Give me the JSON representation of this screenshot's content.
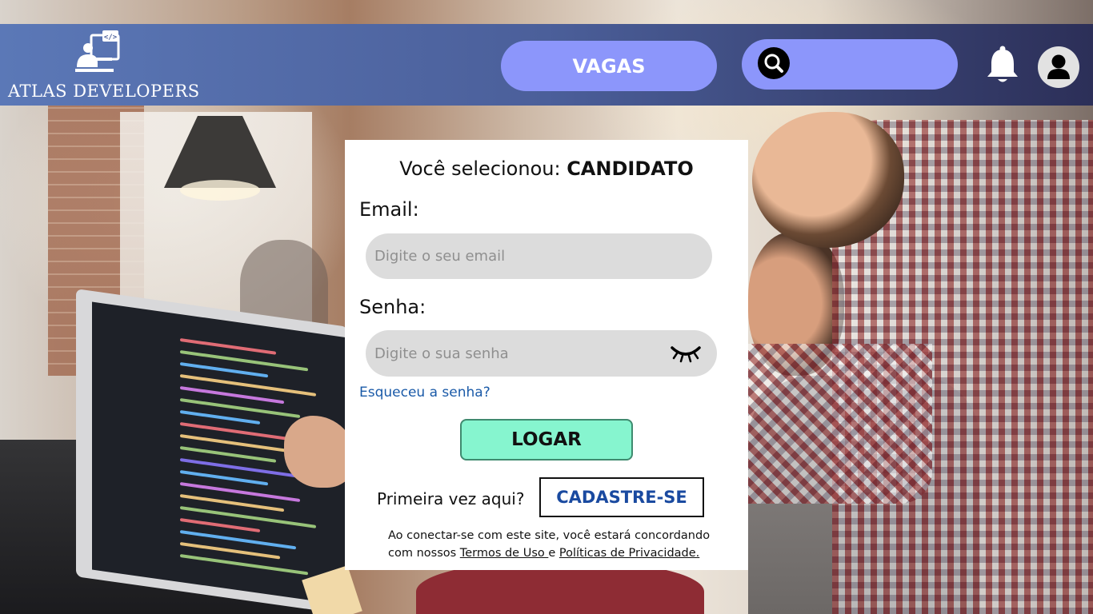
{
  "header": {
    "logo_text": "ATLAS DEVELOPERS",
    "vagas_label": "VAGAS",
    "search_placeholder": ""
  },
  "login": {
    "selected_prefix": "Você selecionou: ",
    "selected_role": "CANDIDATO",
    "email_label": "Email:",
    "email_placeholder": "Digite o seu email",
    "password_label": "Senha:",
    "password_placeholder": "Digite o sua senha",
    "forgot_link": "Esqueceu a senha?",
    "login_button": "LOGAR",
    "first_time_text": "Primeira vez aqui?",
    "signup_button": "CADASTRE-SE",
    "terms_text": "Ao conectar-se com este site, você estará concordando com nossos ",
    "terms_link": "Termos de Uso ",
    "terms_and": "e ",
    "privacy_link": "Políticas de Privacidade."
  },
  "icons": {
    "logo": "developer-computer-icon",
    "search": "search-icon",
    "notifications": "bell-icon",
    "profile": "user-avatar-icon",
    "password_toggle": "closed-eye-icon"
  },
  "colors": {
    "header_start": "#5b78b7",
    "header_end": "#2c2f58",
    "nav_button": "#8c96fb",
    "login_button": "#86f5cf",
    "link": "#1a5aa8",
    "signup_text": "#1a4aa0"
  }
}
